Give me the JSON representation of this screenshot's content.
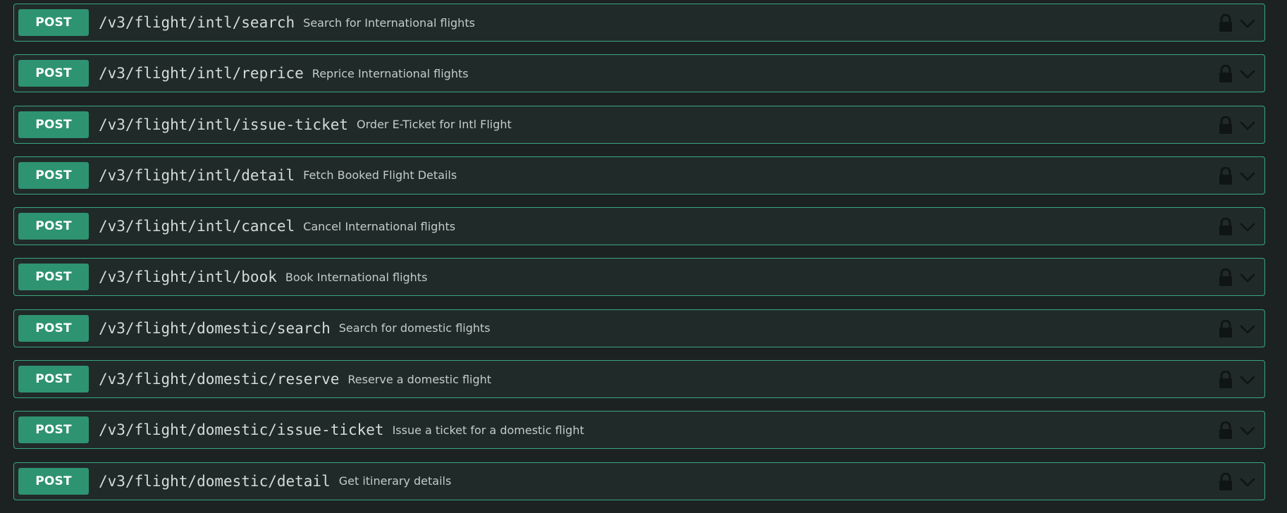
{
  "operations": [
    {
      "method": "POST",
      "path": "/v3/flight/intl/search",
      "summary": "Search for International flights"
    },
    {
      "method": "POST",
      "path": "/v3/flight/intl/reprice",
      "summary": "Reprice International flights"
    },
    {
      "method": "POST",
      "path": "/v3/flight/intl/issue-ticket",
      "summary": "Order E-Ticket for Intl Flight"
    },
    {
      "method": "POST",
      "path": "/v3/flight/intl/detail",
      "summary": "Fetch Booked Flight Details"
    },
    {
      "method": "POST",
      "path": "/v3/flight/intl/cancel",
      "summary": "Cancel International flights"
    },
    {
      "method": "POST",
      "path": "/v3/flight/intl/book",
      "summary": "Book International flights"
    },
    {
      "method": "POST",
      "path": "/v3/flight/domestic/search",
      "summary": "Search for domestic flights"
    },
    {
      "method": "POST",
      "path": "/v3/flight/domestic/reserve",
      "summary": "Reserve a domestic flight"
    },
    {
      "method": "POST",
      "path": "/v3/flight/domestic/issue-ticket",
      "summary": "Issue a ticket for a domestic flight"
    },
    {
      "method": "POST",
      "path": "/v3/flight/domestic/detail",
      "summary": "Get itinerary details"
    }
  ],
  "icons": {
    "lock": "lock-icon",
    "expand": "chevron-down-icon"
  },
  "colors": {
    "background": "#1c2222",
    "block_background": "#202a29",
    "border": "#3aa67f",
    "method_post": "#2e9370",
    "path_text": "#d4dbdb",
    "summary_text": "#c3cccb",
    "icon": "#0f1414"
  }
}
